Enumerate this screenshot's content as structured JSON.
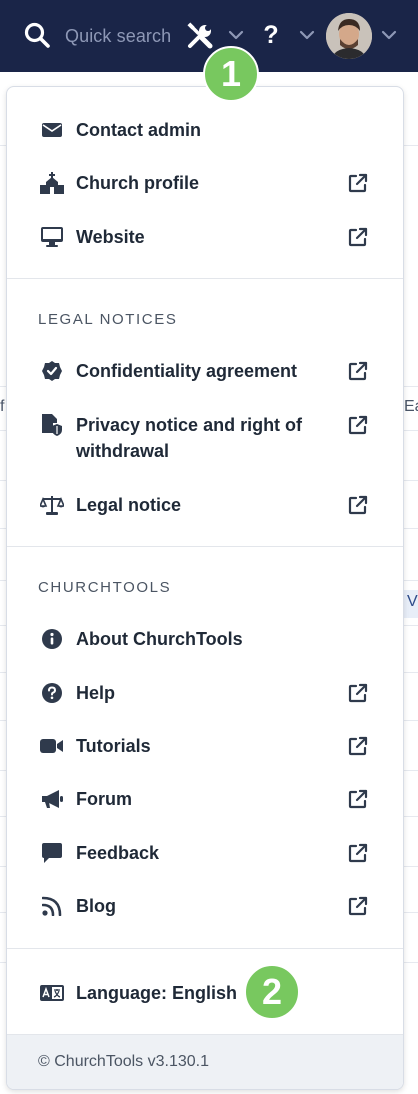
{
  "topbar": {
    "search_placeholder": "Quick search",
    "help_label": "?",
    "bg_color": "#1a2548"
  },
  "background_peek": {
    "left_char": "f",
    "right_text": "Ea",
    "right_tag": "V"
  },
  "menu": {
    "items_top": [
      {
        "label": "Contact admin",
        "icon": "envelope-icon",
        "external": false
      },
      {
        "label": "Church profile",
        "icon": "church-icon",
        "external": true
      },
      {
        "label": "Website",
        "icon": "monitor-icon",
        "external": true
      }
    ],
    "legal": {
      "heading": "LEGAL NOTICES",
      "items": [
        {
          "label": "Confidentiality agreement",
          "icon": "badge-check-icon",
          "external": true
        },
        {
          "label": "Privacy notice and right of withdrawal",
          "icon": "file-shield-icon",
          "external": true
        },
        {
          "label": "Legal notice",
          "icon": "scale-icon",
          "external": true
        }
      ]
    },
    "churchtools": {
      "heading": "CHURCHTOOLS",
      "items": [
        {
          "label": "About ChurchTools",
          "icon": "info-icon",
          "external": false
        },
        {
          "label": "Help",
          "icon": "question-circle-icon",
          "external": true
        },
        {
          "label": "Tutorials",
          "icon": "video-icon",
          "external": true
        },
        {
          "label": "Forum",
          "icon": "megaphone-icon",
          "external": true
        },
        {
          "label": "Feedback",
          "icon": "comment-icon",
          "external": true
        },
        {
          "label": "Blog",
          "icon": "rss-icon",
          "external": true
        }
      ]
    },
    "language": {
      "label": "Language: English",
      "icon": "language-icon"
    },
    "footer": "© ChurchTools v3.130.1"
  },
  "badges": [
    "1",
    "2"
  ],
  "colors": {
    "accent": "#78c85f",
    "text": "#1f2937",
    "icon": "#2f3a4c",
    "muted": "#8e98b6"
  }
}
